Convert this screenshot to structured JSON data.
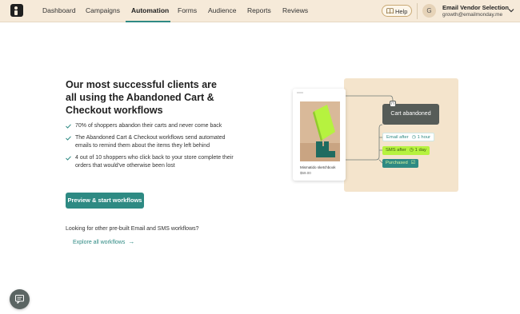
{
  "nav": {
    "items": [
      {
        "label": "Dashboard",
        "active": false
      },
      {
        "label": "Campaigns",
        "active": false
      },
      {
        "label": "Automation",
        "active": true
      },
      {
        "label": "Forms",
        "active": false
      },
      {
        "label": "Audience",
        "active": false
      },
      {
        "label": "Reports",
        "active": false
      },
      {
        "label": "Reviews",
        "active": false
      }
    ],
    "help_label": "Help",
    "account": {
      "initial": "G",
      "name": "Email Vendor Selection",
      "email": "growth@emailmonday.me"
    }
  },
  "main": {
    "headline": "Our most successful clients are all using the Abandoned Cart & Checkout workflows",
    "bullets": [
      "70% of shoppers abandon their carts and never come back",
      "The Abandoned Cart & Checkout workflows send automated emails to remind them about the items they left behind",
      "4 out of 10 shoppers who click back to your store complete their orders that would've otherwise been lost"
    ],
    "cta_label": "Preview & start workflows",
    "other_question": "Looking for other pre-built Email and SMS workflows?",
    "explore_label": "Explore all workflows"
  },
  "illustration": {
    "product_title": "Mismatido sketchbook",
    "product_price": "$59.00",
    "cart_node": "Cart abandoned",
    "steps": [
      {
        "label": "Email after",
        "detail": "1 hour"
      },
      {
        "label": "SMS after",
        "detail": "1 day"
      },
      {
        "label": "Purchased",
        "detail": ""
      }
    ]
  },
  "colors": {
    "nav_bg": "#f6ead9",
    "accent": "#2e8a83",
    "illustration_bg": "#f4e4cc",
    "sms_green": "#b6f23f"
  }
}
